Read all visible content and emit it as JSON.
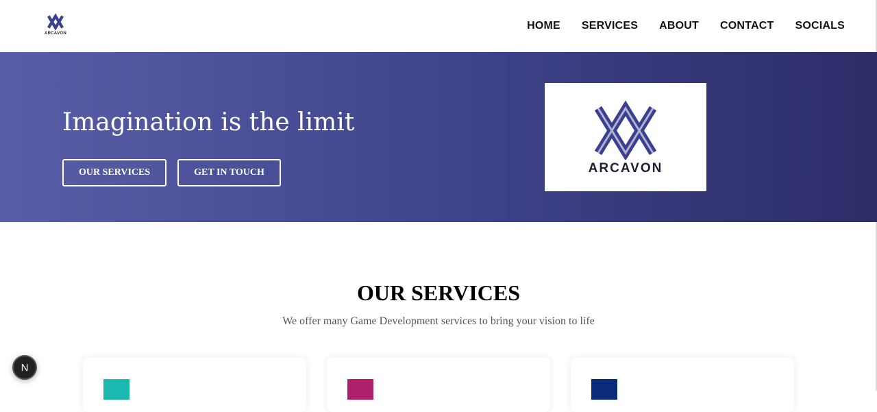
{
  "brand": {
    "name": "ARCAVON"
  },
  "nav": {
    "items": [
      "HOME",
      "SERVICES",
      "ABOUT",
      "CONTACT",
      "SOCIALS"
    ]
  },
  "hero": {
    "title": "Imagination is the limit",
    "buttons": [
      "OUR SERVICES",
      "GET IN TOUCH"
    ]
  },
  "services": {
    "title": "OUR SERVICES",
    "subtitle": "We offer many Game Development services to bring your vision to life",
    "cards": [
      {
        "icon": "game-engine-icon",
        "color": "#1bb8b0"
      },
      {
        "icon": "3d-cube-icon",
        "color": "#b0206a"
      },
      {
        "icon": "blueprint-icon",
        "color": "#0a2a7a"
      }
    ]
  },
  "badge": {
    "label": "N"
  }
}
